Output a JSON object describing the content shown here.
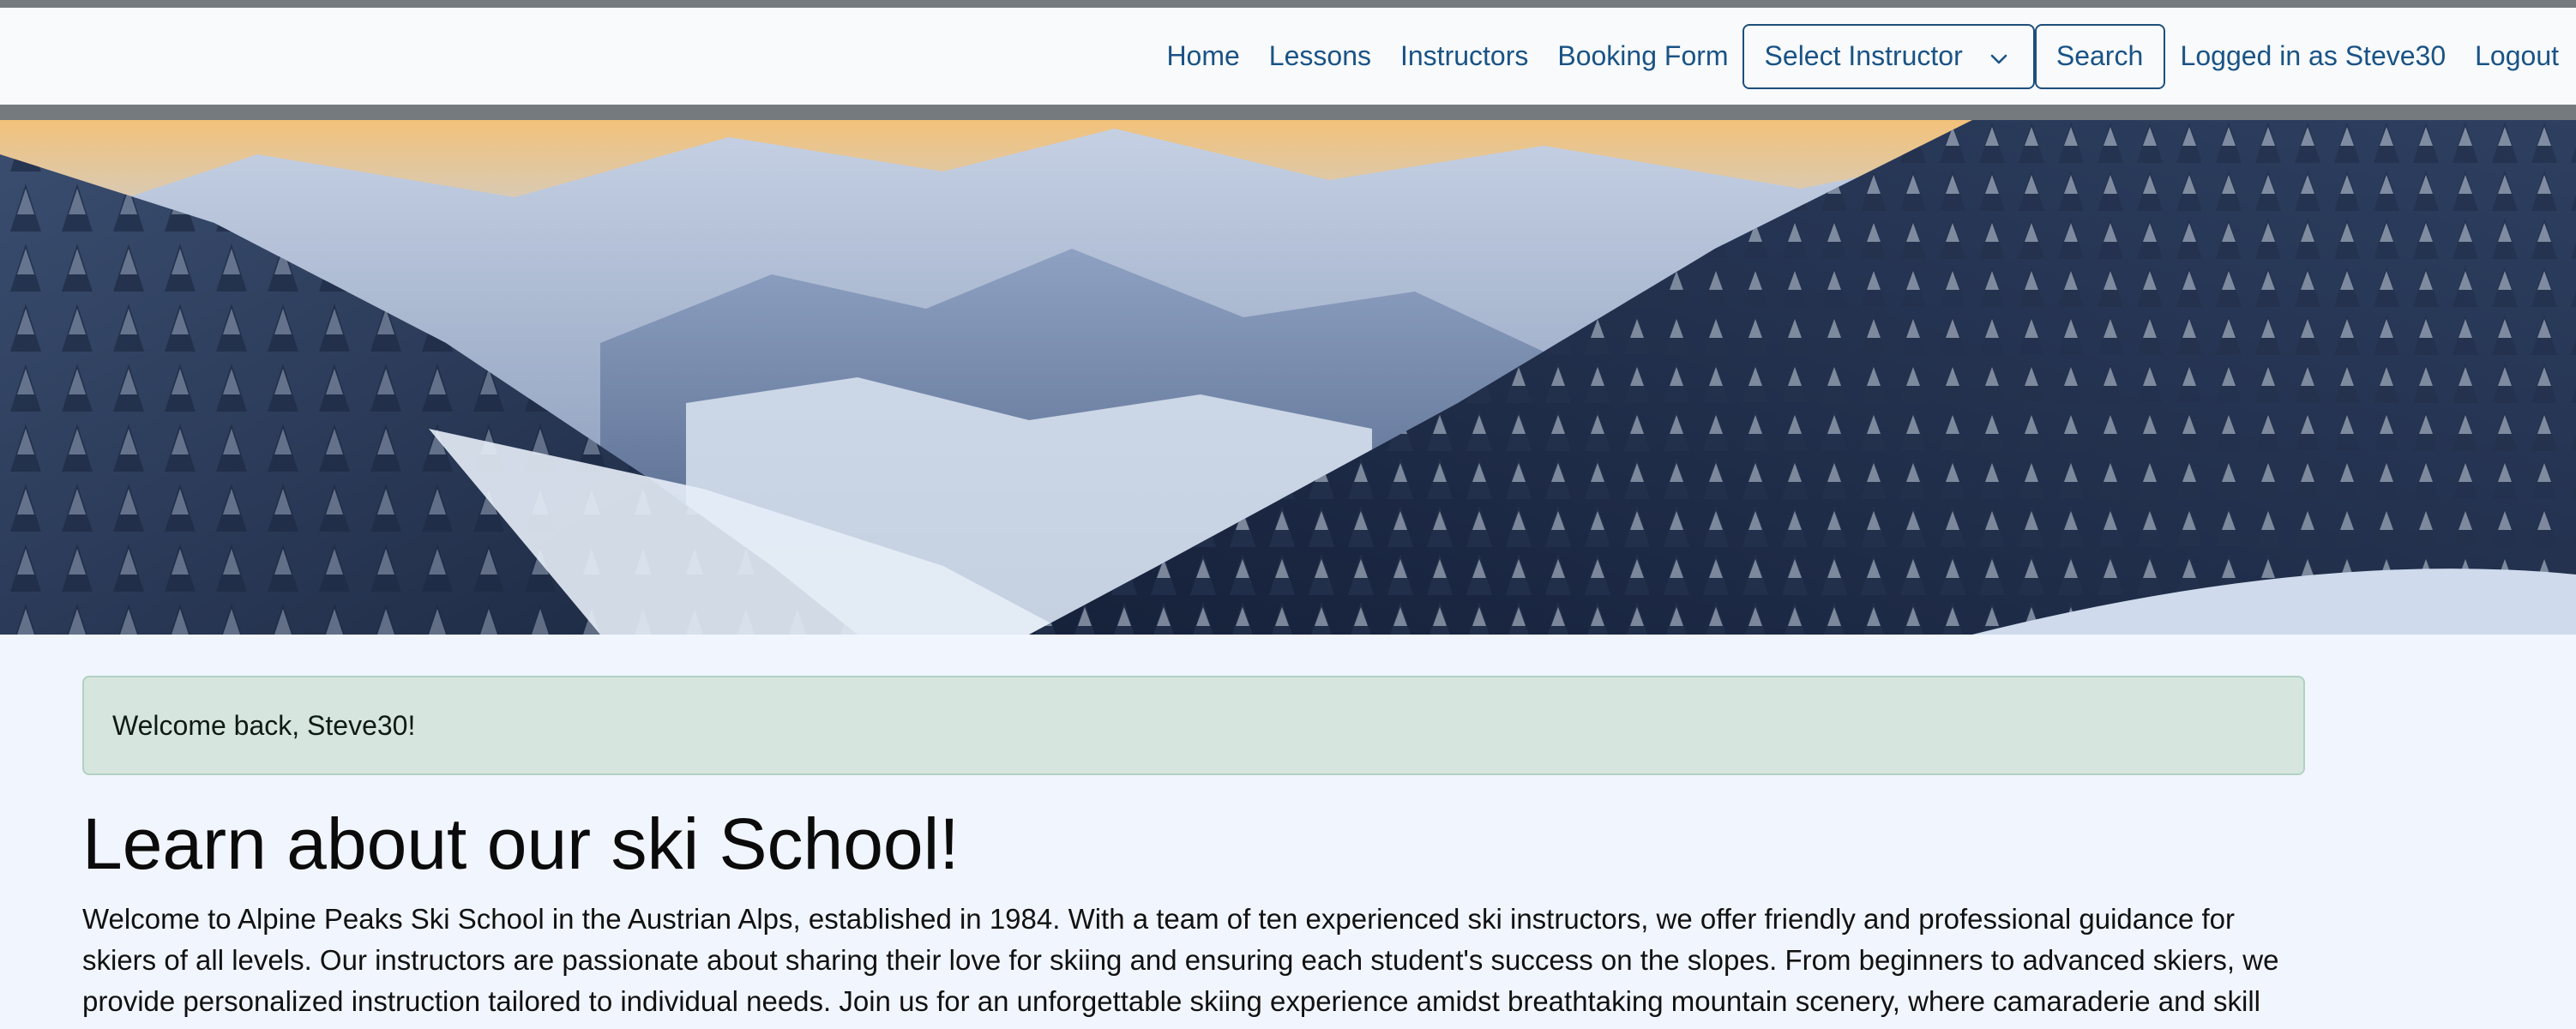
{
  "nav": {
    "links": [
      "Home",
      "Lessons",
      "Instructors",
      "Booking Form"
    ],
    "select": {
      "value": "Select Instructor"
    },
    "search_label": "Search",
    "logged_in_text": "Logged in as Steve30",
    "logout_label": "Logout"
  },
  "alert": {
    "text": "Welcome back, Steve30!"
  },
  "main": {
    "heading": "Learn about our ski School!",
    "paragraph": "Welcome to Alpine Peaks Ski School in the Austrian Alps, established in 1984. With a team of ten experienced ski instructors, we offer friendly and professional guidance for skiers of all levels. Our instructors are passionate about sharing their love for skiing and ensuring each student's success on the slopes. From beginners to advanced skiers, we provide personalized instruction tailored to individual needs. Join us for an unforgettable skiing experience amidst breathtaking mountain scenery, where camaraderie and skill"
  },
  "colors": {
    "link": "#1a5385",
    "alert_bg": "#d6e6df",
    "page_bg": "#f1f5fd",
    "strip": "#757a7e"
  },
  "icons": [
    "chevron-down-icon"
  ]
}
